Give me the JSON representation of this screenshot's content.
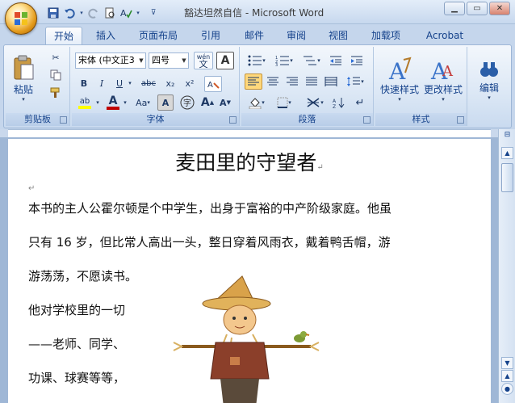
{
  "window": {
    "title": "豁达坦然自信 - Microsoft Word",
    "controls": [
      "minimize-icon",
      "maximize-icon",
      "close-icon"
    ]
  },
  "qat": {
    "icons": [
      "save-icon",
      "undo-icon",
      "redo-icon",
      "print-preview-icon",
      "spelling-icon",
      "customize-icon"
    ]
  },
  "tabs": [
    "开始",
    "插入",
    "页面布局",
    "引用",
    "邮件",
    "审阅",
    "视图",
    "加载项",
    "Acrobat"
  ],
  "ribbon": {
    "clipboard": {
      "label": "剪贴板",
      "paste": "粘贴"
    },
    "font": {
      "label": "字体",
      "font_name": "宋体 (中文正3",
      "font_size": "四号",
      "bold": "B",
      "italic": "I",
      "underline": "U",
      "strike": "abc",
      "sub": "x₂",
      "sup": "x²",
      "change_case": "Aa",
      "grow": "A",
      "shrink": "A",
      "wen": "wén"
    },
    "paragraph": {
      "label": "段落"
    },
    "styles": {
      "label": "样式",
      "quick": "快速样式",
      "change": "更改样式"
    },
    "editing": {
      "label": "编辑"
    },
    "highlight_color": "#ffff00",
    "font_color": "#c00000"
  },
  "document": {
    "title": "麦田里的守望者",
    "lines": [
      "本书的主人公霍尔顿是个中学生，出身于富裕的中产阶级家庭。他虽",
      "只有 16 岁，但比常人高出一头，整日穿着风雨衣，戴着鸭舌帽，游",
      "游荡荡，不愿读书。",
      "他对学校里的一切",
      "——老师、同学、",
      "功课、球赛等等，"
    ]
  }
}
